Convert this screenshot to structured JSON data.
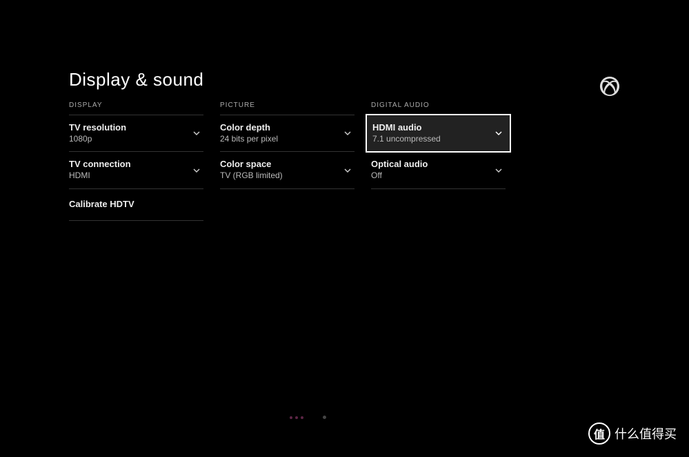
{
  "title": "Display & sound",
  "columns": {
    "display": {
      "header": "DISPLAY",
      "items": [
        {
          "label": "TV resolution",
          "value": "1080p",
          "hasChevron": true
        },
        {
          "label": "TV connection",
          "value": "HDMI",
          "hasChevron": true
        },
        {
          "label": "Calibrate HDTV",
          "value": null,
          "hasChevron": false
        }
      ]
    },
    "picture": {
      "header": "PICTURE",
      "items": [
        {
          "label": "Color depth",
          "value": "24 bits per pixel",
          "hasChevron": true
        },
        {
          "label": "Color space",
          "value": "TV (RGB limited)",
          "hasChevron": true
        }
      ]
    },
    "digital_audio": {
      "header": "DIGITAL AUDIO",
      "items": [
        {
          "label": "HDMI audio",
          "value": "7.1 uncompressed",
          "hasChevron": true,
          "selected": true
        },
        {
          "label": "Optical audio",
          "value": "Off",
          "hasChevron": true
        }
      ]
    }
  },
  "watermark": {
    "badge": "值",
    "text": "什么值得买"
  }
}
